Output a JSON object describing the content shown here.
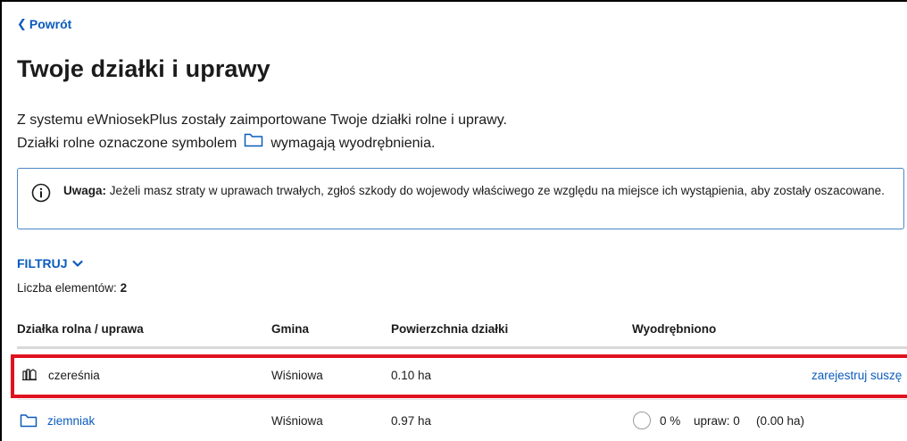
{
  "nav": {
    "back_label": "Powrót"
  },
  "page": {
    "title": "Twoje działki i uprawy",
    "intro_line1": "Z systemu eWniosekPlus zostały zaimportowane Twoje działki rolne i uprawy.",
    "intro_line2_before": "Działki rolne oznaczone symbolem",
    "intro_line2_after": "wymagają wyodrębnienia."
  },
  "alert": {
    "label": "Uwaga:",
    "text": " Jeżeli masz straty w uprawach trwałych, zgłoś szkody do wojewody właściwego ze względu na miejsce ich wystąpienia, aby zostały oszacowane."
  },
  "filter": {
    "label": "FILTRUJ"
  },
  "count": {
    "label": "Liczba elementów:",
    "value": "2"
  },
  "table": {
    "headers": [
      "Działka rolna / uprawa",
      "Gmina",
      "Powierzchnia działki",
      "Wyodrębniono"
    ],
    "rows": [
      {
        "name": "czereśnia",
        "icon": "crop-icon",
        "gmina": "Wiśniowa",
        "area": "0.10 ha",
        "action": "zarejestruj suszę"
      },
      {
        "name": "ziemniak",
        "icon": "folder-icon",
        "gmina": "Wiśniowa",
        "area": "0.97 ha",
        "percent": "0 %",
        "crops": "upraw: 0",
        "crops_area": "(0.00 ha)",
        "progress": 0
      }
    ]
  },
  "colors": {
    "link": "#0b5bbd",
    "highlight": "#e0121f",
    "alert_border": "#4a86c8"
  }
}
